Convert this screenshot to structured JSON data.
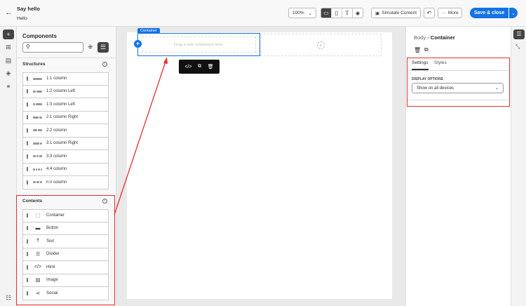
{
  "header": {
    "title": "Say hello",
    "subtitle": "Hello",
    "zoom": "100%",
    "simulate": "Simulate Content",
    "more": "More",
    "save": "Save & close"
  },
  "components": {
    "title": "Components",
    "search_placeholder": "",
    "structures_title": "Structures",
    "structures": [
      {
        "label": "1:1 column",
        "bars": [
          1
        ]
      },
      {
        "label": "1:2 column Left",
        "bars": [
          1,
          2
        ]
      },
      {
        "label": "1:3 column Left",
        "bars": [
          1,
          3
        ]
      },
      {
        "label": "2:1 column Right",
        "bars": [
          2,
          1
        ]
      },
      {
        "label": "2:2 column",
        "bars": [
          1,
          1
        ]
      },
      {
        "label": "3:1 column Right",
        "bars": [
          3,
          1
        ]
      },
      {
        "label": "3:3 column",
        "bars": [
          1,
          1,
          1
        ]
      },
      {
        "label": "4:4 column",
        "bars": [
          1,
          1,
          1,
          1
        ]
      },
      {
        "label": "n:n column",
        "bars": [
          1,
          1,
          0
        ]
      }
    ],
    "contents_title": "Contents",
    "contents": [
      {
        "label": "Container",
        "icon": "container-icon",
        "glyph": "⬚"
      },
      {
        "label": "Button",
        "icon": "button-icon",
        "glyph": "▬"
      },
      {
        "label": "Text",
        "icon": "text-icon",
        "glyph": "T"
      },
      {
        "label": "Divider",
        "icon": "divider-icon",
        "glyph": "☰"
      },
      {
        "label": "Html",
        "icon": "code-icon",
        "glyph": "</>"
      },
      {
        "label": "Image",
        "icon": "image-icon",
        "glyph": "▨"
      },
      {
        "label": "Social",
        "icon": "share-icon",
        "glyph": "⋖"
      }
    ]
  },
  "canvas": {
    "container_tag": "Container",
    "drop_hint": "Drag a new component here."
  },
  "properties": {
    "breadcrumb_parent": "Body",
    "breadcrumb_current": "Container",
    "tabs": [
      "Settings",
      "Styles"
    ],
    "active_tab": "Settings",
    "display_label": "DISPLAY OPTIONS",
    "display_value": "Show on all devices"
  },
  "colors": {
    "accent": "#1473e6",
    "highlight": "#e03030"
  }
}
